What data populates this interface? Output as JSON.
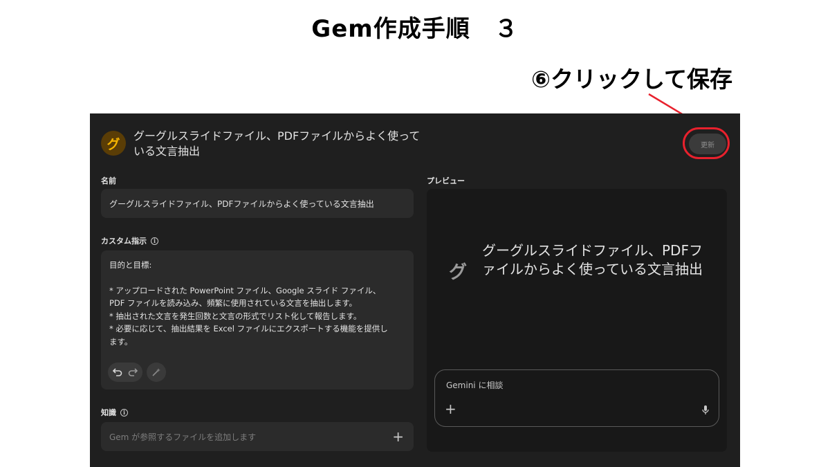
{
  "slide": {
    "title": "Gem作成手順　３",
    "callout": "⑥クリックして保存"
  },
  "colors": {
    "accent_red": "#e8212d",
    "app_bg": "#1f1f1f",
    "avatar_fg": "#f5b400"
  },
  "gem": {
    "avatar_letter": "グ",
    "title": "グーグルスライドファイル、PDFファイルからよく使っている文言抽出",
    "update_label": "更新"
  },
  "form": {
    "name_label": "名前",
    "name_value": "グーグルスライドファイル、PDFファイルからよく使っている文言抽出",
    "instructions_label": "カスタム指示",
    "instructions_lines": [
      "目的と目標:",
      "",
      "* アップロードされた PowerPoint ファイル、Google スライド ファイル、",
      "PDF ファイルを読み込み、頻繁に使用されている文言を抽出します。",
      "* 抽出された文言を発生回数と文言の形式でリスト化して報告します。",
      "* 必要に応じて、抽出結果を Excel ファイルにエクスポートする機能を提供し",
      "ます。"
    ],
    "knowledge_label": "知識",
    "knowledge_placeholder": "Gem が参照するファイルを追加します"
  },
  "preview": {
    "label": "プレビュー",
    "gem_letter": "グ",
    "gem_title": "グーグルスライドファイル、PDFファイルからよく使っている文言抽出",
    "chat_placeholder": "Gemini に相談"
  },
  "icons": {
    "info": "info-icon",
    "undo": "undo-icon",
    "redo": "redo-icon",
    "magic": "magic-wand-icon",
    "add": "plus-icon",
    "mic": "microphone-icon"
  }
}
